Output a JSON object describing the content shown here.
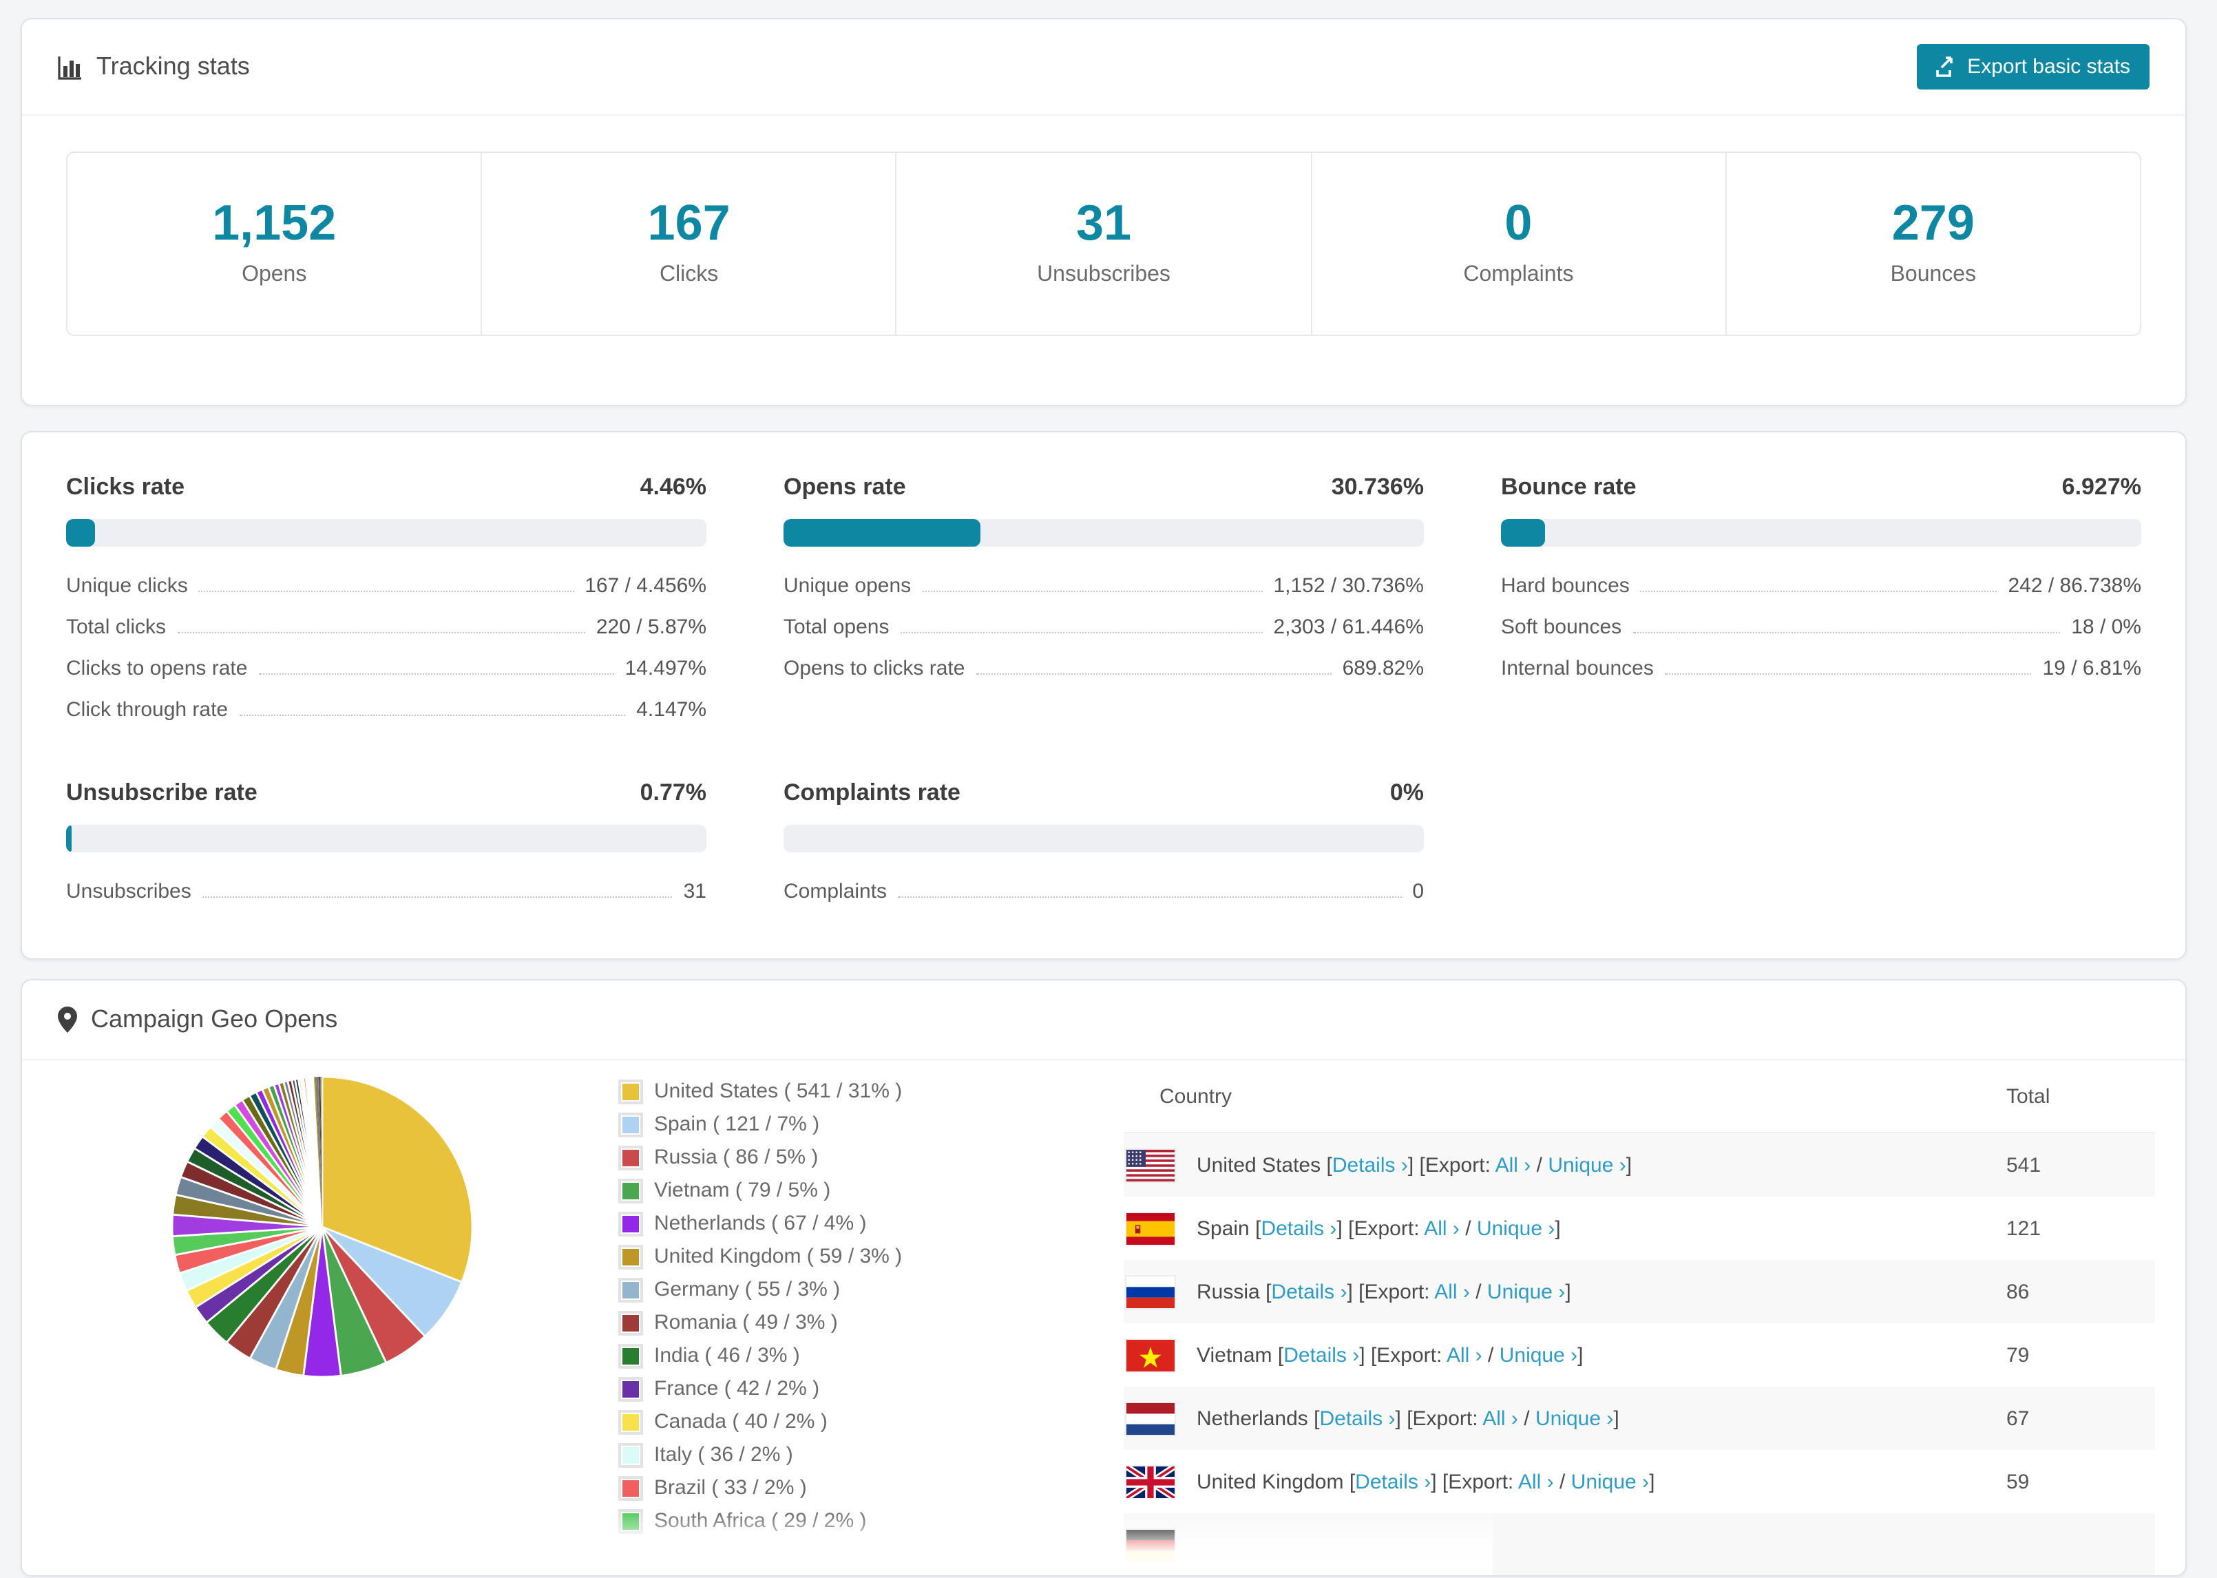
{
  "accent": "#0d87a2",
  "link_color": "#2d9dc7",
  "header": {
    "title": "Tracking stats",
    "export_label": "Export basic stats"
  },
  "summary_stats": [
    {
      "value": "1,152",
      "label": "Opens"
    },
    {
      "value": "167",
      "label": "Clicks"
    },
    {
      "value": "31",
      "label": "Unsubscribes"
    },
    {
      "value": "0",
      "label": "Complaints"
    },
    {
      "value": "279",
      "label": "Bounces"
    }
  ],
  "rate_blocks": [
    {
      "title": "Clicks rate",
      "value": "4.46%",
      "percent": 4.46,
      "rows": [
        {
          "label": "Unique clicks",
          "value": "167 / 4.456%"
        },
        {
          "label": "Total clicks",
          "value": "220 / 5.87%"
        },
        {
          "label": "Clicks to opens rate",
          "value": "14.497%"
        },
        {
          "label": "Click through rate",
          "value": "4.147%"
        }
      ]
    },
    {
      "title": "Opens rate",
      "value": "30.736%",
      "percent": 30.736,
      "rows": [
        {
          "label": "Unique opens",
          "value": "1,152 / 30.736%"
        },
        {
          "label": "Total opens",
          "value": "2,303 / 61.446%"
        },
        {
          "label": "Opens to clicks rate",
          "value": "689.82%"
        }
      ]
    },
    {
      "title": "Bounce rate",
      "value": "6.927%",
      "percent": 6.927,
      "rows": [
        {
          "label": "Hard bounces",
          "value": "242 / 86.738%"
        },
        {
          "label": "Soft bounces",
          "value": "18 / 0%"
        },
        {
          "label": "Internal bounces",
          "value": "19 / 6.81%"
        }
      ]
    },
    {
      "title": "Unsubscribe rate",
      "value": "0.77%",
      "percent": 0.77,
      "rows": [
        {
          "label": "Unsubscribes",
          "value": "31"
        }
      ]
    },
    {
      "title": "Complaints rate",
      "value": "0%",
      "percent": 0,
      "rows": [
        {
          "label": "Complaints",
          "value": "0"
        }
      ]
    }
  ],
  "geo": {
    "title": "Campaign Geo Opens",
    "table": {
      "col_country": "Country",
      "col_total": "Total",
      "bracket_open": "[",
      "bracket_close": "]",
      "link_details": "Details ›",
      "export_prefix": "[Export:",
      "link_all": "All ›",
      "separator": "/",
      "link_unique": "Unique ›",
      "rows": [
        {
          "country": "United States",
          "flag": "us",
          "total": "541"
        },
        {
          "country": "Spain",
          "flag": "es",
          "total": "121"
        },
        {
          "country": "Russia",
          "flag": "ru",
          "total": "86"
        },
        {
          "country": "Vietnam",
          "flag": "vn",
          "total": "79"
        },
        {
          "country": "Netherlands",
          "flag": "nl",
          "total": "67"
        },
        {
          "country": "United Kingdom",
          "flag": "gb",
          "total": "59"
        },
        {
          "country": "",
          "flag": "de",
          "total": "",
          "partial": true
        }
      ]
    }
  },
  "chart_data": {
    "type": "pie",
    "title": "Campaign Geo Opens",
    "unit": "opens",
    "direction": "clockwise",
    "start_angle_deg": 0,
    "legend_position": "right-of-pie",
    "labeled_slices": [
      {
        "country": "United States",
        "opens": 541,
        "pct": 31,
        "color": "#e9c23b"
      },
      {
        "country": "Spain",
        "opens": 121,
        "pct": 7,
        "color": "#aed3f2"
      },
      {
        "country": "Russia",
        "opens": 86,
        "pct": 5,
        "color": "#cb4b4c"
      },
      {
        "country": "Vietnam",
        "opens": 79,
        "pct": 5,
        "color": "#4aa64f"
      },
      {
        "country": "Netherlands",
        "opens": 67,
        "pct": 4,
        "color": "#9428e8"
      },
      {
        "country": "United Kingdom",
        "opens": 59,
        "pct": 3,
        "color": "#be9727"
      },
      {
        "country": "Germany",
        "opens": 55,
        "pct": 3,
        "color": "#93b5ce"
      },
      {
        "country": "Romania",
        "opens": 49,
        "pct": 3,
        "color": "#9d3b36"
      },
      {
        "country": "India",
        "opens": 46,
        "pct": 3,
        "color": "#287d2e"
      },
      {
        "country": "France",
        "opens": 42,
        "pct": 2,
        "color": "#6930a8"
      },
      {
        "country": "Canada",
        "opens": 40,
        "pct": 2,
        "color": "#f8e14b"
      },
      {
        "country": "Italy",
        "opens": 36,
        "pct": 2,
        "color": "#dbfbf8"
      },
      {
        "country": "Brazil",
        "opens": 33,
        "pct": 2,
        "color": "#f1605f"
      },
      {
        "country": "South Africa",
        "opens": 29,
        "pct": 2,
        "color": "#55cb5c"
      }
    ],
    "legend_format": "{country} ( {opens} / {pct}% )",
    "unlabeled_slices_estimated": {
      "total_pct": 26,
      "relative_values": [
        26,
        24,
        22,
        20,
        18,
        17,
        15,
        14,
        13,
        12,
        11,
        10,
        9,
        8,
        8,
        7,
        6,
        6,
        5,
        5,
        4,
        4,
        3,
        3,
        3,
        2,
        2,
        2,
        2,
        1.8,
        1.5,
        1.3,
        1.1,
        1,
        0.9,
        0.8,
        0.7,
        0.6,
        0.5,
        0.4,
        0.35,
        0.3,
        0.25,
        0.2
      ],
      "palette": [
        "#a03ce0",
        "#8a7a22",
        "#6f8496",
        "#7e2c2c",
        "#1e5c2a",
        "#2a2070",
        "#f5e84a",
        "#eafcfb",
        "#fa5f5f",
        "#4ee04e",
        "#d44ae0",
        "#6b6b14",
        "#10505a",
        "#8f2be0",
        "#c09529",
        "#47a34b"
      ]
    }
  }
}
